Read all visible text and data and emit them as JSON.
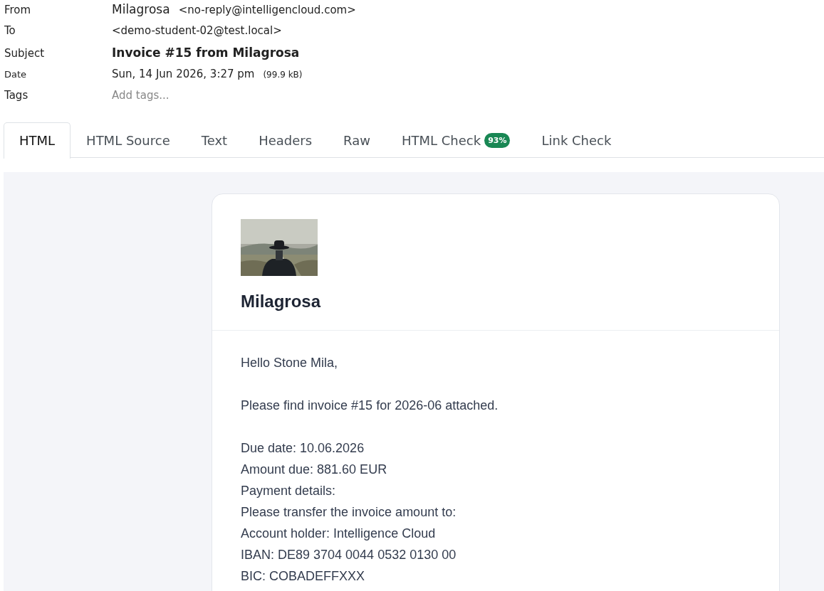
{
  "header": {
    "from": {
      "label": "From",
      "name": "Milagrosa",
      "address": "<no-reply@intelligencloud.com>"
    },
    "to": {
      "label": "To",
      "value": "<demo-student-02@test.local>"
    },
    "subject": {
      "label": "Subject",
      "value": "Invoice #15 from Milagrosa"
    },
    "date": {
      "label": "Date",
      "value": "Sun, 14 Jun 2026, 3:27 pm",
      "size": "(99.9 kB)"
    },
    "tags": {
      "label": "Tags",
      "placeholder": "Add tags..."
    }
  },
  "tabs": [
    {
      "label": "HTML",
      "selected": true
    },
    {
      "label": "HTML Source",
      "selected": false
    },
    {
      "label": "Text",
      "selected": false
    },
    {
      "label": "Headers",
      "selected": false
    },
    {
      "label": "Raw",
      "selected": false
    },
    {
      "label": "HTML Check",
      "selected": false,
      "badge": "93%"
    },
    {
      "label": "Link Check",
      "selected": false
    }
  ],
  "email": {
    "sender": "Milagrosa",
    "paragraphs": [
      [
        "Hello Stone Mila,"
      ],
      [
        "Please find invoice #15 for 2026-06 attached."
      ],
      [
        "Due date: 10.06.2026",
        "Amount due: 881.60 EUR",
        "Payment details:",
        "Please transfer the invoice amount to:",
        "Account holder: Intelligence Cloud",
        "IBAN: DE89 3704 0044 0532 0130 00",
        "BIC: COBADEFFXXX"
      ]
    ]
  }
}
